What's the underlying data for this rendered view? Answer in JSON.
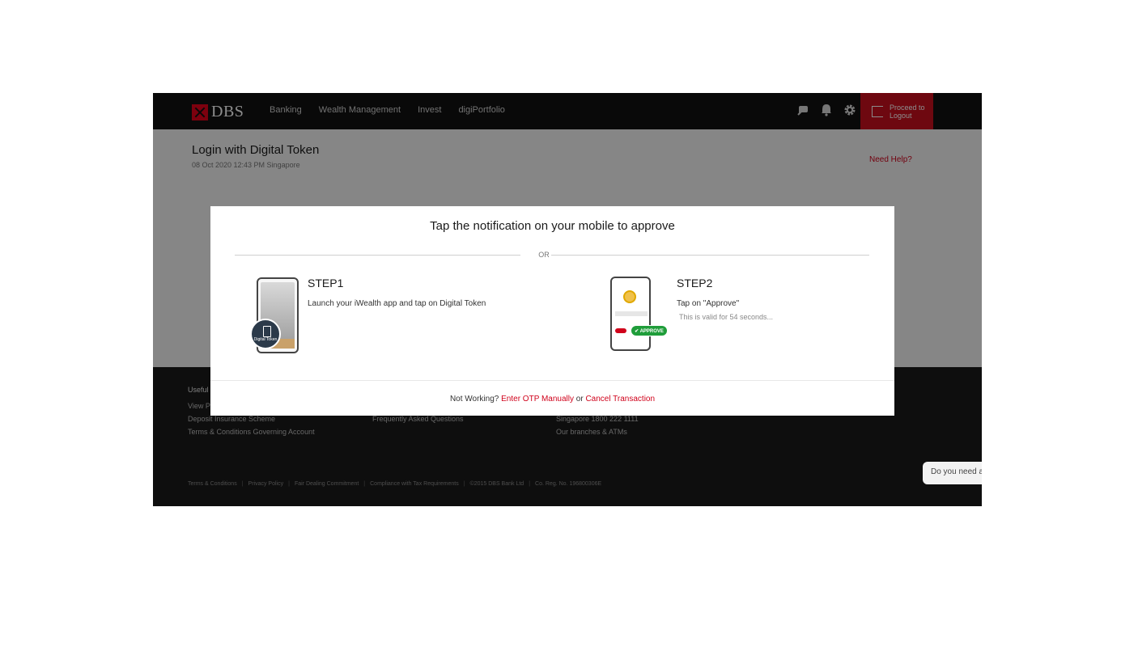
{
  "header": {
    "brand": "DBS",
    "nav": [
      "Banking",
      "Wealth Management",
      "Invest",
      "digiPortfolio"
    ],
    "icons": [
      "chat-support-icon",
      "bell-icon",
      "gear-icon"
    ],
    "logout_label": "Proceed to Logout"
  },
  "page": {
    "title": "Login with Digital Token",
    "date": "08 Oct 2020 12:43 PM Singapore",
    "need_help": "Need Help?"
  },
  "footer": {
    "col1": {
      "heading": "Useful",
      "items": [
        "View P",
        "Deposit Insurance Scheme",
        "Terms & Conditions Governing Account"
      ]
    },
    "col2": {
      "items": [
        "Frequently Asked Questions"
      ]
    },
    "col3": {
      "items": [
        "Singapore 1800 222 1111",
        "Our branches & ATMs"
      ]
    },
    "legal": [
      "Terms & Conditions",
      "Privacy Policy",
      "Fair Dealing Commitment",
      "Compliance with Tax Requirements",
      "©2015 DBS Bank Ltd",
      "Co. Reg. No. 196800306E"
    ],
    "separator": "|"
  },
  "chat": {
    "text": "Do you need a"
  },
  "modal": {
    "title": "Tap the notification on your mobile to approve",
    "or": "OR",
    "step1": {
      "title": "STEP1",
      "desc": "Launch your iWealth app and tap on Digital Token",
      "badge": "Digital Token"
    },
    "step2": {
      "title": "STEP2",
      "desc": "Tap on \"Approve\"",
      "valid": "This is valid for 54 seconds...",
      "approve_label": "✔ APPROVE"
    },
    "footer": {
      "prefix": "Not Working?",
      "otp_link": "Enter OTP Manually",
      "or": "or",
      "cancel_link": "Cancel Transaction"
    }
  },
  "colors": {
    "brand_red": "#e4001b",
    "link_red": "#d0021b",
    "approve_green": "#1f9d3a",
    "header_bg": "#111111"
  }
}
